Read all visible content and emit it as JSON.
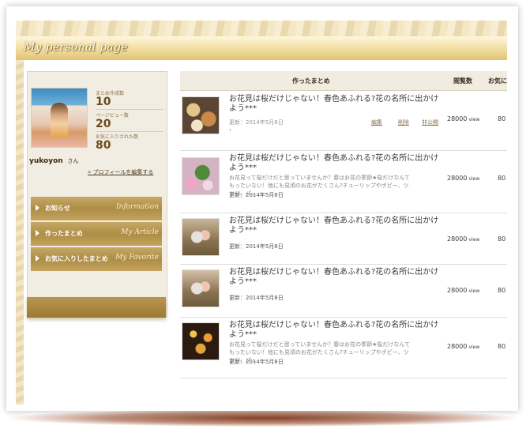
{
  "banner": {
    "title": "My personal page"
  },
  "profile": {
    "stats": [
      {
        "label": "まとめ作成数",
        "value": "10"
      },
      {
        "label": "ページビュー数",
        "value": "20"
      },
      {
        "label": "お気に入りされた数",
        "value": "80"
      }
    ],
    "username": "yukoyon",
    "honorific": "さん",
    "edit_link": "» プロフィールを編集する"
  },
  "nav": [
    {
      "label": "お知らせ",
      "script": "Information"
    },
    {
      "label": "作ったまとめ",
      "script": "My Article"
    },
    {
      "label": "お気に入りしたまとめ",
      "script": "My Favorite"
    }
  ],
  "table": {
    "headers": {
      "title": "作ったまとめ",
      "views": "閲覧数",
      "favorites": "お気に"
    },
    "rows": [
      {
        "title": "お花見は桜だけじゃない！春色あふれる?花の名所に出かけよう***",
        "date": "更新：2014年5月8日",
        "extra": ".",
        "actions": [
          "編集",
          "削除",
          "非公開"
        ],
        "views": "28000",
        "unit": "view",
        "fav": "80",
        "thumb": "food-photo"
      },
      {
        "title": "お花見は桜だけじゃない！春色あふれる?花の名所に出かけよう***",
        "desc": "お花見って桜だけだと思っていませんか？春はお花の季節★桜だけなんてもったいない！他にも見頃のお花がたくさん?チューリップやポピー、ツツジ、パ…",
        "date": "更新：2014年5月8日",
        "views": "28000",
        "unit": "view",
        "fav": "80",
        "thumb": "sweets-photo"
      },
      {
        "title": "お花見は桜だけじゃない！春色あふれる?花の名所に出かけよう***",
        "date": "更新：2014年5月8日",
        "views": "28000",
        "unit": "view",
        "fav": "80",
        "thumb": "couple-photo"
      },
      {
        "title": "お花見は桜だけじゃない！春色あふれる?花の名所に出かけよう***",
        "date": "更新：2014年5月8日",
        "views": "28000",
        "unit": "view",
        "fav": "80",
        "thumb": "couple-photo"
      },
      {
        "title": "お花見は桜だけじゃない！春色あふれる?花の名所に出かけよう***",
        "desc": "お花見って桜だけだと思っていませんか？春はお花の季節★桜だけなんてもったいない！他にも見頃のお花がたくさん?チューリップやポピー、ツツジ、パ…",
        "date": "更新：2014年5月8日",
        "views": "28000",
        "unit": "view",
        "fav": "80",
        "thumb": "night-street-photo"
      }
    ]
  },
  "colors": {
    "accent": "#b39349",
    "banner": "#f0dc9e"
  }
}
